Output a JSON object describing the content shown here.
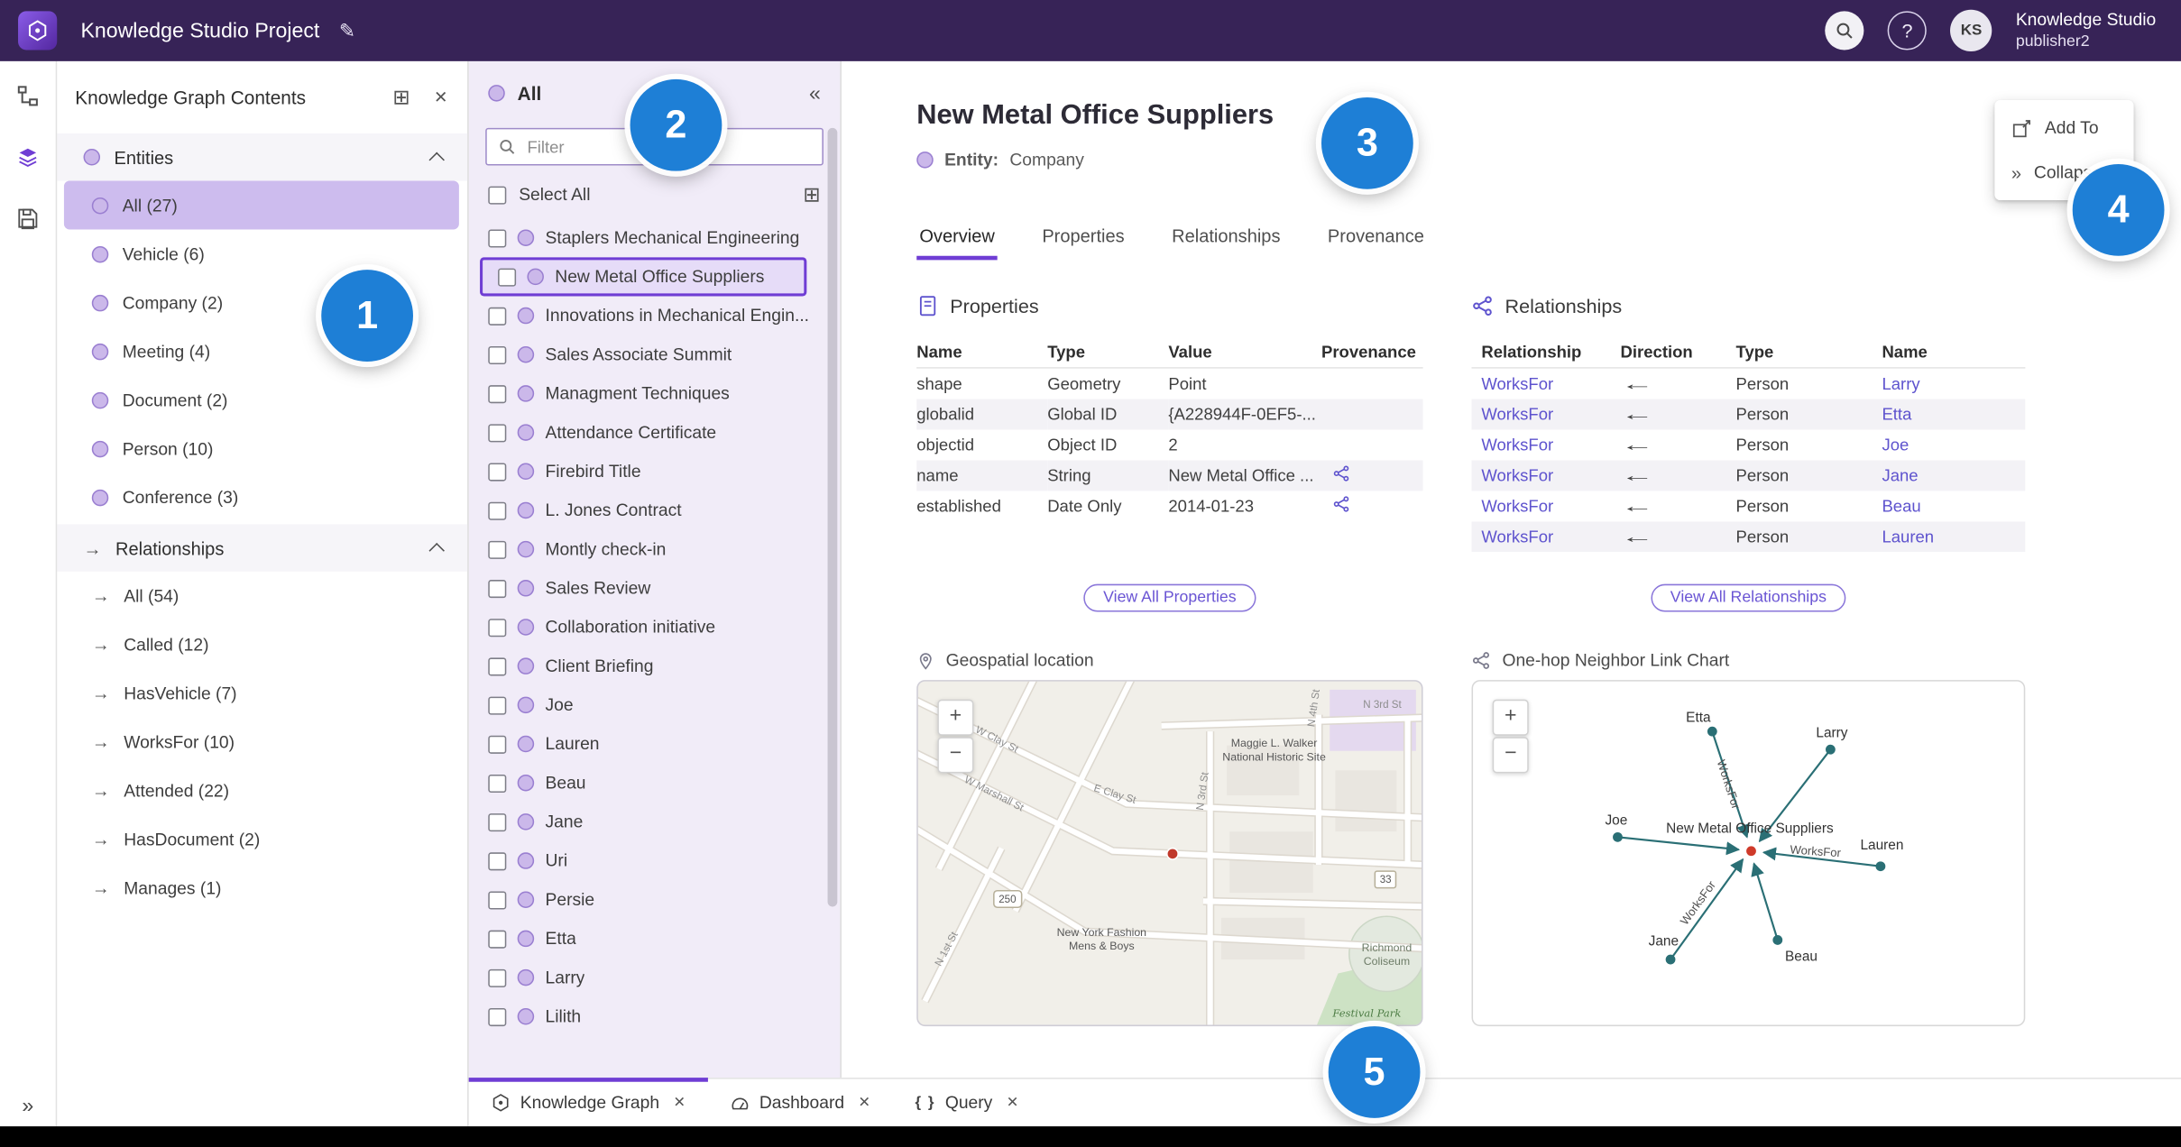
{
  "colors": {
    "accent": "#6f3dd4",
    "link": "#5e53ce",
    "header_bg": "#372357",
    "annotation_blue": "#1e7fd6",
    "selected_row": "#cdbcee",
    "panel_bg": "#f1ecf8",
    "graph_teal": "#2a6f75",
    "marker_red": "#cf3a2a"
  },
  "icons": {
    "edit": "✎",
    "help": "?",
    "close": "✕",
    "add_box": "⊞",
    "collapse": "«",
    "expand": "»",
    "arrow_right": "→",
    "query": "{ }",
    "zoom_in": "+",
    "zoom_out": "−"
  },
  "header": {
    "title": "Knowledge Studio Project",
    "account_name": "Knowledge Studio",
    "account_sub": "publisher2",
    "avatar_initials": "KS"
  },
  "contents_panel": {
    "title": "Knowledge Graph Contents",
    "entities_header": "Entities",
    "relationships_header": "Relationships",
    "entities": [
      {
        "label": "All (27)"
      },
      {
        "label": "Vehicle (6)"
      },
      {
        "label": "Company (2)"
      },
      {
        "label": "Meeting (4)"
      },
      {
        "label": "Document (2)"
      },
      {
        "label": "Person (10)"
      },
      {
        "label": "Conference (3)"
      }
    ],
    "relationships": [
      {
        "label": "All (54)"
      },
      {
        "label": "Called (12)"
      },
      {
        "label": "HasVehicle (7)"
      },
      {
        "label": "WorksFor (10)"
      },
      {
        "label": "Attended (22)"
      },
      {
        "label": "HasDocument (2)"
      },
      {
        "label": "Manages (1)"
      }
    ]
  },
  "list_panel": {
    "title": "All",
    "filter_placeholder": "Filter",
    "select_all_label": "Select All",
    "items": [
      {
        "label": "Staplers Mechanical Engineering"
      },
      {
        "label": "New Metal Office Suppliers"
      },
      {
        "label": "Innovations in Mechanical Engin..."
      },
      {
        "label": "Sales Associate Summit"
      },
      {
        "label": "Managment Techniques"
      },
      {
        "label": "Attendance Certificate"
      },
      {
        "label": "Firebird Title"
      },
      {
        "label": "L. Jones Contract"
      },
      {
        "label": "Montly check-in"
      },
      {
        "label": "Sales Review"
      },
      {
        "label": "Collaboration initiative"
      },
      {
        "label": "Client Briefing"
      },
      {
        "label": "Joe"
      },
      {
        "label": "Lauren"
      },
      {
        "label": "Beau"
      },
      {
        "label": "Jane"
      },
      {
        "label": "Uri"
      },
      {
        "label": "Persie"
      },
      {
        "label": "Etta"
      },
      {
        "label": "Larry"
      },
      {
        "label": "Lilith"
      }
    ]
  },
  "detail": {
    "title": "New Metal Office Suppliers",
    "entity_label": "Entity:",
    "entity_type": "Company",
    "tabs": [
      {
        "label": "Overview"
      },
      {
        "label": "Properties"
      },
      {
        "label": "Relationships"
      },
      {
        "label": "Provenance"
      }
    ],
    "float_menu": {
      "add_to": "Add To",
      "collapse": "Collapse"
    },
    "properties": {
      "heading": "Properties",
      "columns": [
        "Name",
        "Type",
        "Value",
        "Provenance"
      ],
      "rows": [
        {
          "name": "shape",
          "type": "Geometry",
          "value": "Point"
        },
        {
          "name": "globalid",
          "type": "Global ID",
          "value": "{A228944F-0EF5-..."
        },
        {
          "name": "objectid",
          "type": "Object ID",
          "value": "2"
        },
        {
          "name": "name",
          "type": "String",
          "value": "New Metal Office ..."
        },
        {
          "name": "established",
          "type": "Date Only",
          "value": "2014-01-23"
        }
      ],
      "view_all": "View All Properties"
    },
    "relationships": {
      "heading": "Relationships",
      "columns": [
        "Relationship",
        "Direction",
        "Type",
        "Name"
      ],
      "rows": [
        {
          "relationship": "WorksFor",
          "direction": "←",
          "type": "Person",
          "name": "Larry"
        },
        {
          "relationship": "WorksFor",
          "direction": "←",
          "type": "Person",
          "name": "Etta"
        },
        {
          "relationship": "WorksFor",
          "direction": "←",
          "type": "Person",
          "name": "Joe"
        },
        {
          "relationship": "WorksFor",
          "direction": "←",
          "type": "Person",
          "name": "Jane"
        },
        {
          "relationship": "WorksFor",
          "direction": "←",
          "type": "Person",
          "name": "Beau"
        },
        {
          "relationship": "WorksFor",
          "direction": "←",
          "type": "Person",
          "name": "Lauren"
        }
      ],
      "view_all": "View All Relationships"
    },
    "map": {
      "heading": "Geospatial location",
      "labels": {
        "w_clay": "W Clay St",
        "e_clay": "E Clay St",
        "w_marshall": "W Marshall St",
        "n_1st": "N 1st St",
        "n_3rd": "N 3rd St",
        "n_4th": "N 4th St",
        "historic_site": "Maggie L. Walker National Historic Site",
        "fashion": "New York Fashion Mens & Boys",
        "coliseum": "Richmond Coliseum",
        "park": "Festival Park",
        "shield_250": "250",
        "shield_33": "33"
      }
    },
    "link_chart": {
      "heading": "One-hop Neighbor Link Chart",
      "center_label": "New Metal Office Suppliers",
      "edge_label": "WorksFor",
      "nodes": [
        {
          "label": "Etta"
        },
        {
          "label": "Larry"
        },
        {
          "label": "Joe"
        },
        {
          "label": "Lauren"
        },
        {
          "label": "Jane"
        },
        {
          "label": "Beau"
        }
      ]
    }
  },
  "bottom_tabs": [
    {
      "label": "Knowledge Graph"
    },
    {
      "label": "Dashboard"
    },
    {
      "label": "Query"
    }
  ],
  "annotations": [
    {
      "n": "1"
    },
    {
      "n": "2"
    },
    {
      "n": "3"
    },
    {
      "n": "4"
    },
    {
      "n": "5"
    }
  ]
}
